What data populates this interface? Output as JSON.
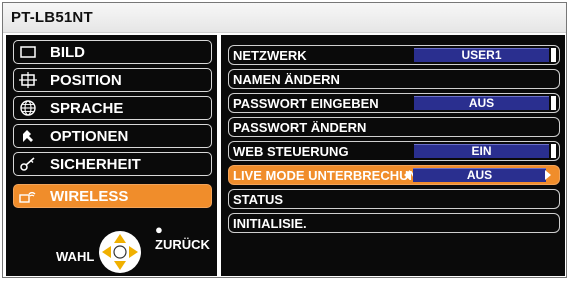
{
  "window": {
    "title": "PT-LB51NT"
  },
  "left_menu": {
    "items": [
      {
        "label": "BILD",
        "icon": "picture-icon",
        "active": false
      },
      {
        "label": "POSITION",
        "icon": "position-icon",
        "active": false
      },
      {
        "label": "SPRACHE",
        "icon": "globe-icon",
        "active": false
      },
      {
        "label": "OPTIONEN",
        "icon": "options-icon",
        "active": false
      },
      {
        "label": "SICHERHEIT",
        "icon": "key-icon",
        "active": false
      },
      {
        "label": "WIRELESS",
        "icon": "wireless-icon",
        "active": true
      }
    ]
  },
  "nav_hint": {
    "select_label": "WAHL",
    "back_label": "ZURÜCK"
  },
  "settings": {
    "items": [
      {
        "label": "NETZWERK",
        "value": "USER1"
      },
      {
        "label": "NAMEN ÄNDERN",
        "value": ""
      },
      {
        "label": "PASSWORT EINGEBEN",
        "value": "AUS"
      },
      {
        "label": "PASSWORT ÄNDERN",
        "value": ""
      },
      {
        "label": "WEB STEUERUNG",
        "value": "EIN"
      },
      {
        "label": "LIVE MODE UNTERBRECHUNG",
        "value": "AUS"
      },
      {
        "label": "STATUS",
        "value": ""
      },
      {
        "label": "INITIALISIE.",
        "value": ""
      }
    ]
  },
  "colors": {
    "active": "#f08d2b",
    "value_bg": "#2a2f8f",
    "panel_bg": "#0a0a0a"
  }
}
